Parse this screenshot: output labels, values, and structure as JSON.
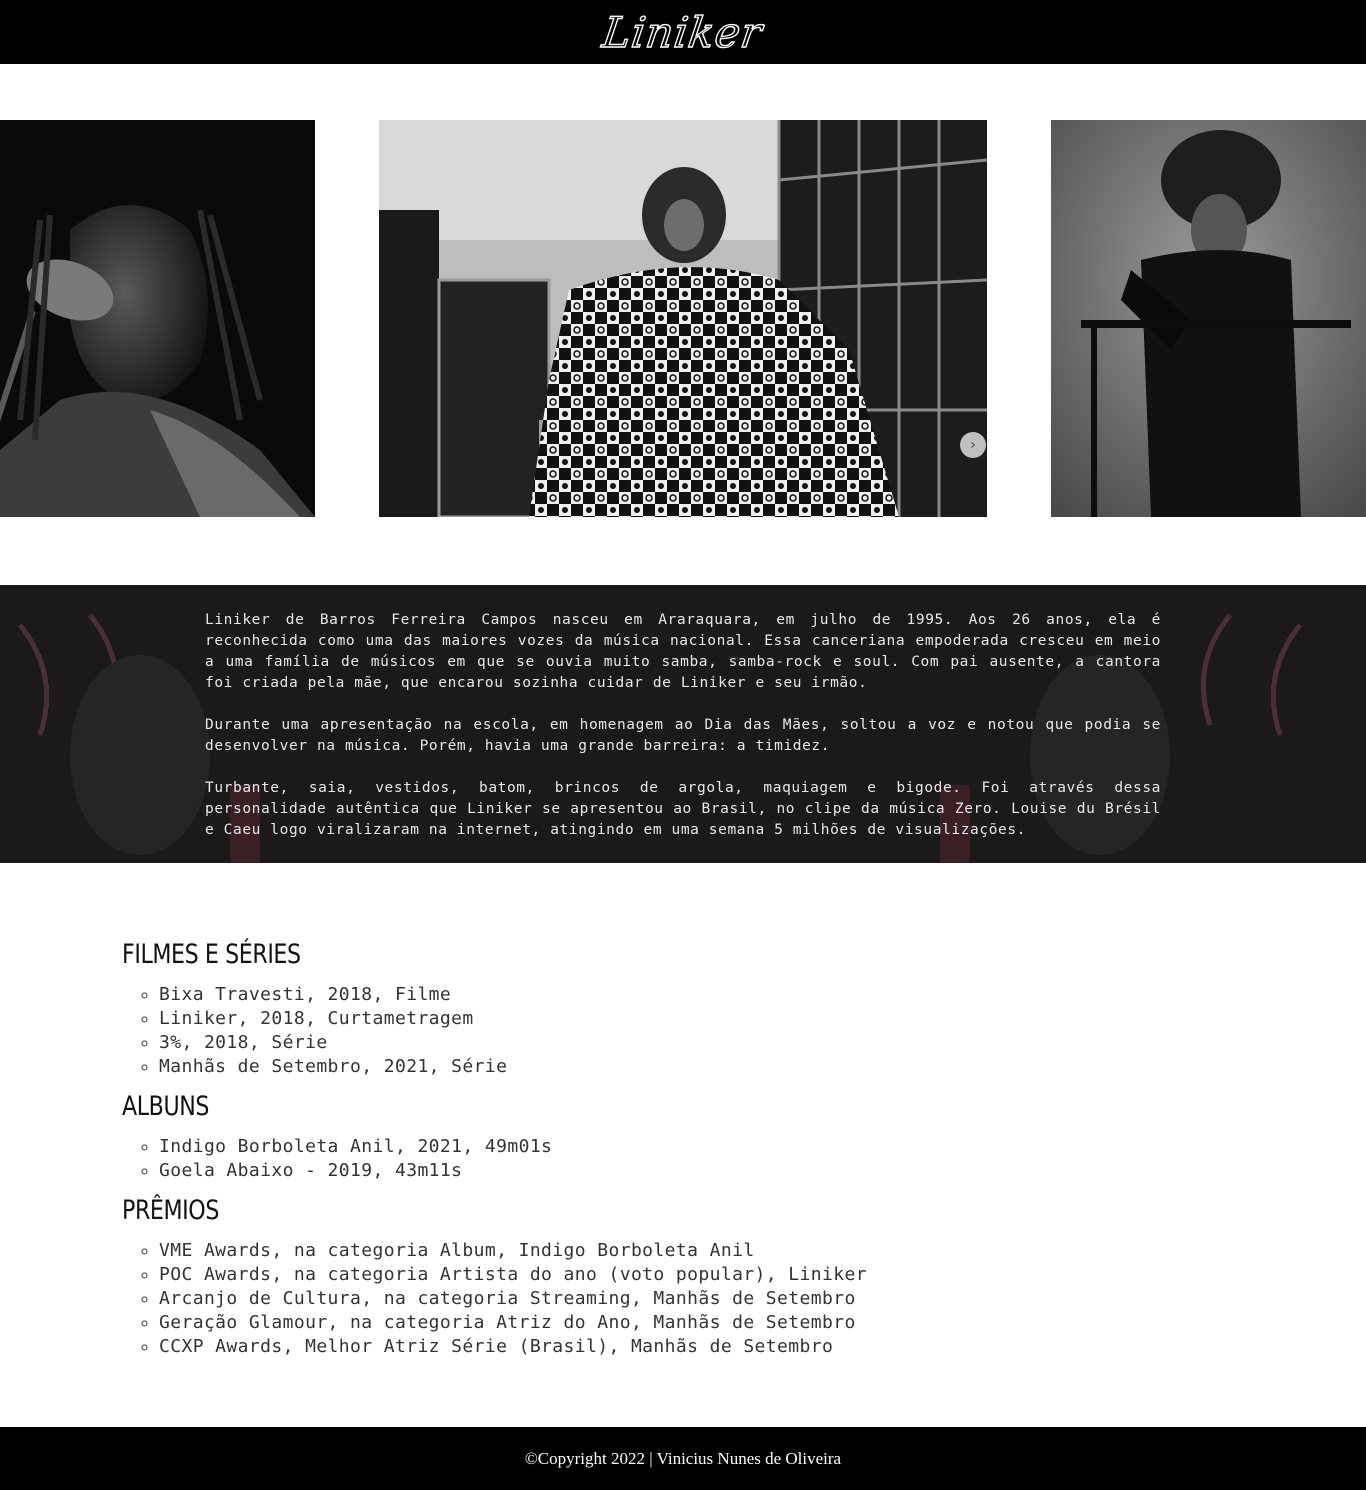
{
  "header": {
    "logo_text": "Liniker"
  },
  "gallery": {
    "photos": [
      {
        "name": "singer-at-microphone"
      },
      {
        "name": "backstage-patterned-dress"
      },
      {
        "name": "portrait-gloves"
      }
    ]
  },
  "bio": {
    "paragraphs": [
      "Liniker de Barros Ferreira Campos nasceu em Araraquara, em julho de 1995. Aos 26 anos, ela é reconhecida como uma das maiores vozes da música nacional. Essa canceriana empoderada cresceu em meio a uma família de músicos em que se ouvia muito samba, samba-rock e soul. Com pai ausente, a cantora foi criada pela mãe, que encarou sozinha cuidar de Liniker e seu irmão.",
      "Durante uma apresentação na escola, em homenagem ao Dia das Mães, soltou a voz e notou que podia se desenvolver na música. Porém, havia uma grande barreira: a timidez.",
      "Turbante, saia, vestidos, batom, brincos de argola, maquiagem e bigode. Foi através dessa personalidade autêntica que Liniker se apresentou ao Brasil, no clipe da música Zero. Louise du Brésil e Caeu logo viralizaram na internet, atingindo em uma semana 5 milhões de visualizações."
    ]
  },
  "filmes": {
    "title": "FILMES E SÉRIES",
    "items": [
      "Bixa Travesti, 2018, Filme",
      "Liniker, 2018, Curtametragem",
      "3%, 2018, Série",
      "Manhãs de Setembro, 2021, Série"
    ]
  },
  "albuns": {
    "title": "ALBUNS",
    "items": [
      "Indigo Borboleta Anil, 2021, 49m01s",
      "Goela Abaixo - 2019, 43m11s"
    ]
  },
  "premios": {
    "title": "PRÊMIOS",
    "items": [
      "VME Awards, na categoria Album, Indigo Borboleta Anil",
      "POC Awards, na categoria Artista do ano (voto popular), Liniker",
      "Arcanjo de Cultura, na categoria Streaming, Manhãs de Setembro",
      "Geração Glamour, na categoria Atriz do Ano, Manhãs de Setembro",
      "CCXP Awards, Melhor Atriz Série (Brasil), Manhãs de Setembro"
    ]
  },
  "footer": {
    "copyright": "©Copyright 2022 | Vinicius Nunes de Oliveira"
  }
}
